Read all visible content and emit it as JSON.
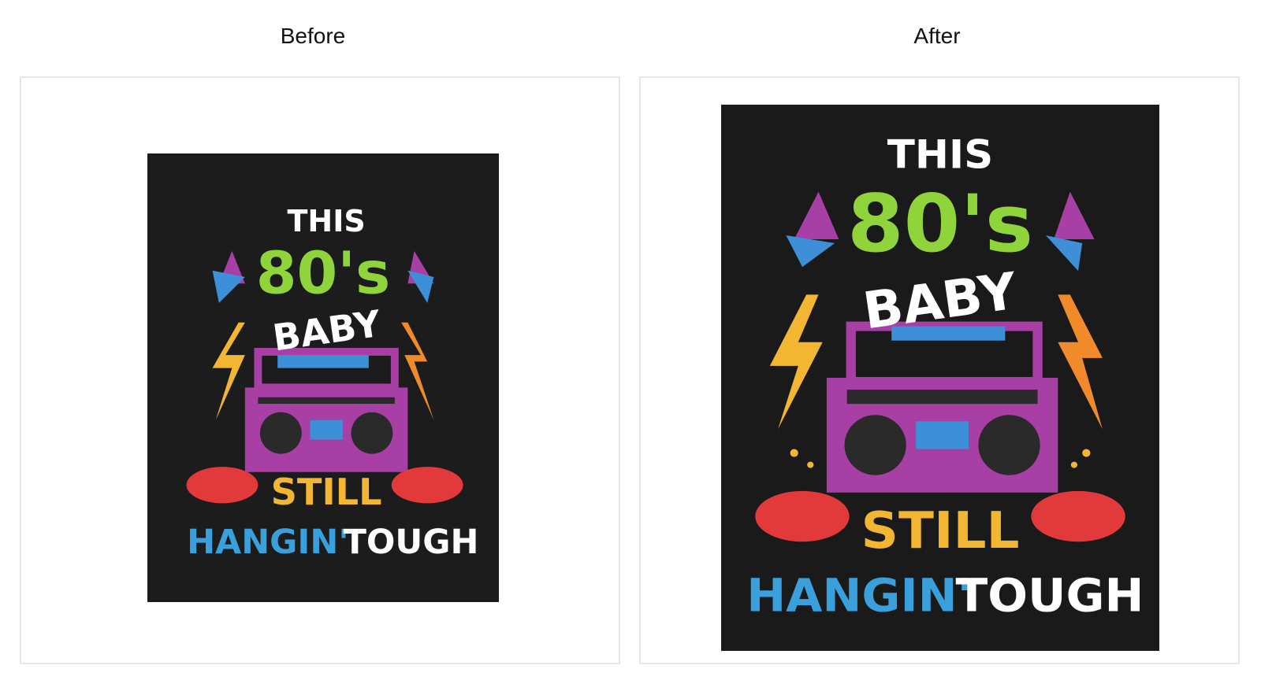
{
  "labels": {
    "before": "Before",
    "after": "After"
  },
  "artwork": {
    "line1": "THIS",
    "line2": "80's",
    "line3": "BABY",
    "line4": "STILL",
    "line5a": "HANGIN'",
    "line5b": "TOUGH"
  },
  "colors": {
    "background": "#1a1a1a",
    "white": "#ffffff",
    "green": "#8fd43b",
    "purple": "#a83fa5",
    "blue": "#3d8fd8",
    "yellow": "#f2b632",
    "orange": "#f08a2b",
    "red": "#e23a3a",
    "lightblue": "#3aa0dc"
  }
}
